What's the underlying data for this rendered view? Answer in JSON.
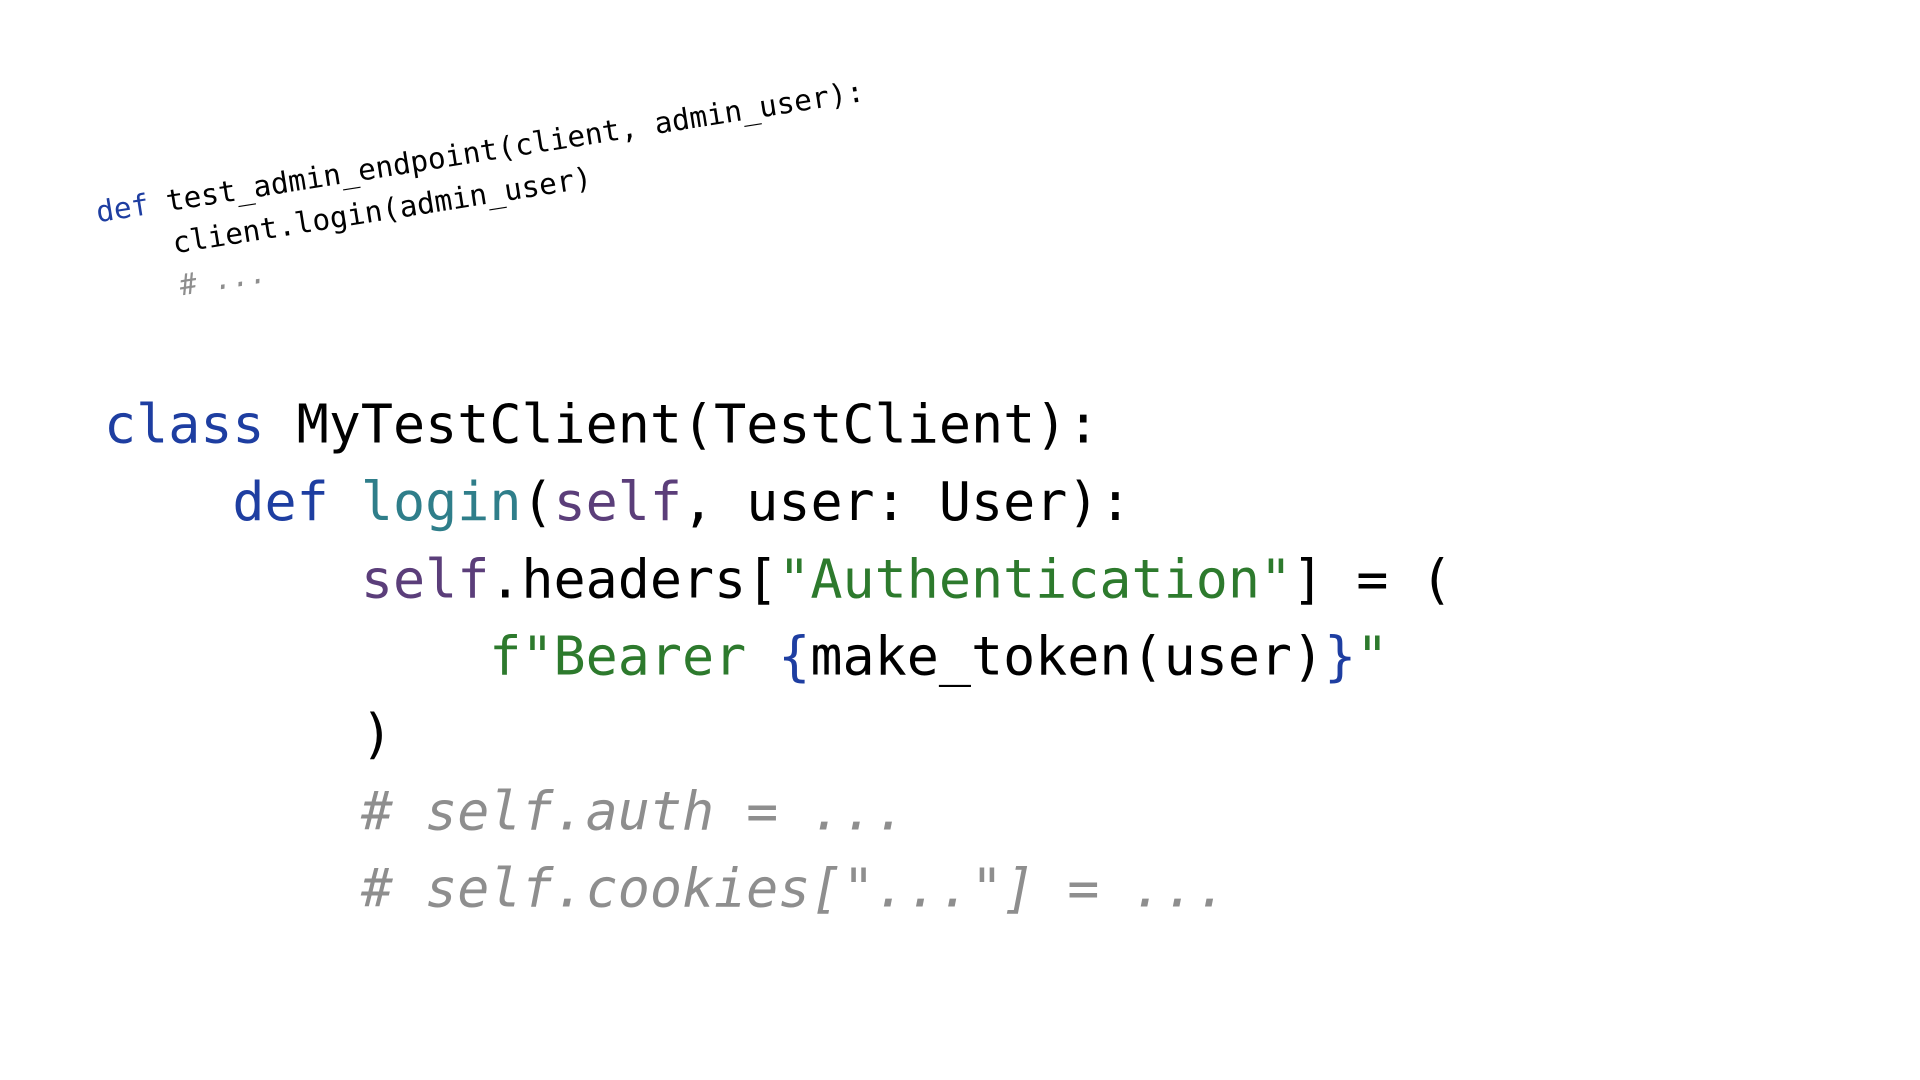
{
  "top": {
    "kw": "def",
    "fname": "test_admin_endpoint",
    "params": "(client, admin_user):",
    "line2": "    client.login(admin_user)",
    "line3_comment": "# ..."
  },
  "main": {
    "kw_class": "class",
    "class_name": "MyTestClient",
    "class_rest": "(TestClient):",
    "kw_def": "def",
    "method_name": "login",
    "sig_open": "(",
    "self": "self",
    "sig_rest": ", user: User):",
    "self2": "self",
    "headers_tail": ".headers[",
    "hdr_key": "\"Authentication\"",
    "hdr_after": "] = (",
    "fstr_prefix": "f",
    "fstr_open": "\"Bearer ",
    "brace_open": "{",
    "fstr_expr": "make_token(user)",
    "brace_close": "}",
    "fstr_close": "\"",
    "close_paren": "        )",
    "cmt1": "# self.auth = ...",
    "cmt2": "# self.cookies[\"...\"] = ..."
  }
}
